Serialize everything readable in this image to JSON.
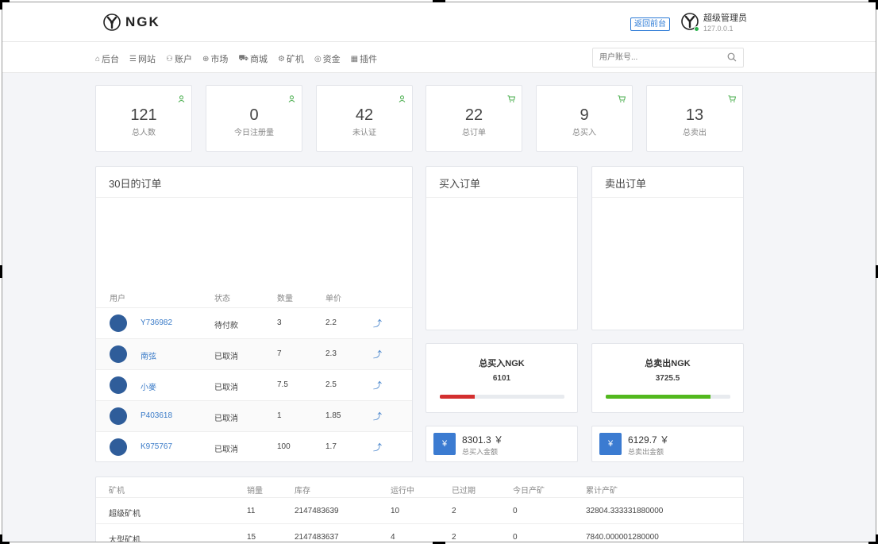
{
  "header": {
    "brand": "NGK",
    "back_button": "返回前台",
    "user_name": "超级管理员",
    "user_ip": "127.0.0.1"
  },
  "nav": {
    "items": [
      {
        "label": "后台",
        "icon": "home-icon"
      },
      {
        "label": "网站",
        "icon": "list-icon"
      },
      {
        "label": "账户",
        "icon": "users-icon"
      },
      {
        "label": "市场",
        "icon": "globe-icon"
      },
      {
        "label": "商城",
        "icon": "cart-icon"
      },
      {
        "label": "矿机",
        "icon": "gear-icon"
      },
      {
        "label": "资金",
        "icon": "money-icon"
      },
      {
        "label": "插件",
        "icon": "grid-icon"
      }
    ],
    "search_placeholder": "用户账号..."
  },
  "stats": [
    {
      "value": "121",
      "label": "总人数",
      "icon": "user-icon"
    },
    {
      "value": "0",
      "label": "今日注册量",
      "icon": "user-icon"
    },
    {
      "value": "42",
      "label": "未认证",
      "icon": "user-icon"
    },
    {
      "value": "22",
      "label": "总订单",
      "icon": "cart-icon"
    },
    {
      "value": "9",
      "label": "总买入",
      "icon": "cart-icon"
    },
    {
      "value": "13",
      "label": "总卖出",
      "icon": "cart-icon"
    }
  ],
  "orders": {
    "title": "30日的订单",
    "columns": [
      "用户",
      "状态",
      "数量",
      "单价"
    ],
    "rows": [
      {
        "user": "Y736982",
        "status": "待付款",
        "qty": "3",
        "price": "2.2"
      },
      {
        "user": "南弦",
        "status": "已取消",
        "qty": "7",
        "price": "2.3"
      },
      {
        "user": "小麥",
        "status": "已取消",
        "qty": "7.5",
        "price": "2.5"
      },
      {
        "user": "P403618",
        "status": "已取消",
        "qty": "1",
        "price": "1.85"
      },
      {
        "user": "K975767",
        "status": "已取消",
        "qty": "100",
        "price": "1.7"
      }
    ]
  },
  "buy_orders": {
    "title": "买入订单"
  },
  "sell_orders": {
    "title": "卖出订单"
  },
  "totals": {
    "buy": {
      "title": "总买入NGK",
      "value": "6101",
      "progress": 0.28,
      "color": "#d32f2f"
    },
    "sell": {
      "title": "总卖出NGK",
      "value": "3725.5",
      "progress": 0.84,
      "color": "#52b81e"
    }
  },
  "amounts": {
    "buy": {
      "symbol": "¥",
      "value": "8301.3 ￥",
      "label": "总买入金额"
    },
    "sell": {
      "symbol": "¥",
      "value": "6129.7 ￥",
      "label": "总卖出金额"
    }
  },
  "miners": {
    "columns": [
      "矿机",
      "销量",
      "库存",
      "运行中",
      "已过期",
      "今日产矿",
      "累计产矿"
    ],
    "rows": [
      {
        "name": "超级矿机",
        "sales": "11",
        "stock": "2147483639",
        "running": "10",
        "expired": "2",
        "today": "0",
        "total": "32804.333331880000"
      },
      {
        "name": "大型矿机",
        "sales": "15",
        "stock": "2147483637",
        "running": "4",
        "expired": "2",
        "today": "0",
        "total": "7840.000001280000"
      }
    ]
  }
}
